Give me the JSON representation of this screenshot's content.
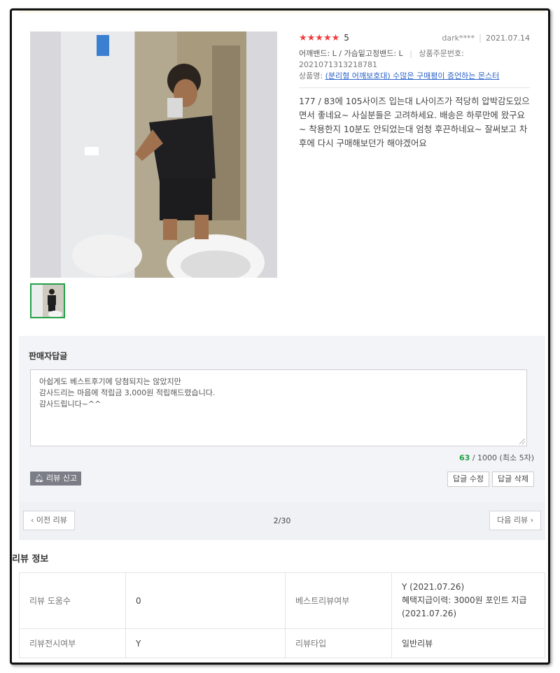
{
  "review": {
    "stars": "★★★★★",
    "score": "5",
    "writer": "dark****",
    "date": "2021.07.14",
    "options": "어깨밴드: L / 가슴밑고정밴드: L",
    "order_label": "상품주문번호:",
    "order_number": "2021071313218781",
    "product_label": "상품명:",
    "product_name": "(분리형 어깨보호대) 수많은 구매평이 증언하는 몬스터",
    "content": "177 / 83에 105사이즈 입는대 L사이즈가 적당히 압박감도있으면서 좋네요~ 사실분들은 고려하세요. 배송은 하루만에 왔구요~ 착용한지 10분도 안되었는대 엄청 후끈하네요~ 잘써보고 차후에 다시 구매해보던가 해야겠어요"
  },
  "reply": {
    "title": "판매자답글",
    "lines": [
      "아쉽게도 베스트후기에 당첨되지는 않았지만",
      "감사드리는 마음에 적립금 3,000원 적립해드렸습니다.",
      "감사드립니다~^^"
    ],
    "count_current": "63",
    "count_rest": " / 1000 (최소 5자)",
    "report_label": "리뷰 신고",
    "edit_label": "답글 수정",
    "delete_label": "답글 삭제"
  },
  "pager": {
    "prev_label": "이전 리뷰",
    "next_label": "다음 리뷰",
    "page": "2/30"
  },
  "info": {
    "title": "리뷰 정보",
    "helpful_label": "리뷰 도움수",
    "helpful_value": "0",
    "best_label": "베스트리뷰여부",
    "best_lines": [
      "Y (2021.07.26)",
      "혜택지급이력: 3000원 포인트 지급",
      "(2021.07.26)"
    ],
    "display_label": "리뷰전시여부",
    "display_value": "Y",
    "type_label": "리뷰타입",
    "type_value": "일반리뷰"
  },
  "colors": {
    "star": "#f23b3b",
    "counter_current": "#24a148",
    "link": "#2a62c9",
    "thumb_border": "#24a148"
  }
}
